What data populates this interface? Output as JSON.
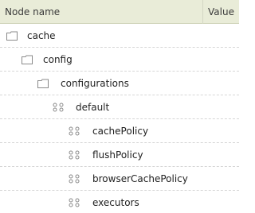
{
  "header": {
    "name_label": "Node name",
    "value_label": "Value"
  },
  "rows": [
    {
      "label": "cache",
      "icon": "folder-icon"
    },
    {
      "label": "config",
      "icon": "folder-icon"
    },
    {
      "label": "configurations",
      "icon": "folder-icon"
    },
    {
      "label": "default",
      "icon": "node-icon"
    },
    {
      "label": "cachePolicy",
      "icon": "node-icon"
    },
    {
      "label": "flushPolicy",
      "icon": "node-icon"
    },
    {
      "label": "browserCachePolicy",
      "icon": "node-icon"
    },
    {
      "label": "executors",
      "icon": "node-icon"
    }
  ]
}
